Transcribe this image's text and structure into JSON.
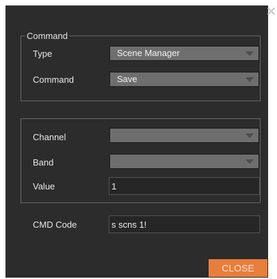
{
  "dialog": {
    "close_glyph": "✕"
  },
  "command_group": {
    "legend": "Command",
    "type_label": "Type",
    "type_value": "Scene Manager",
    "command_label": "Command",
    "command_value": "Save"
  },
  "params_group": {
    "channel_label": "Channel",
    "channel_value": "",
    "band_label": "Band",
    "band_value": "",
    "value_label": "Value",
    "value_value": "1"
  },
  "cmd_code": {
    "label": "CMD Code",
    "value": "s scns 1!"
  },
  "footer": {
    "close_label": "CLOSE"
  },
  "colors": {
    "background": "#2c2c2c",
    "close_button": "#e87e3c",
    "select_fill": "#6e6e6e"
  }
}
